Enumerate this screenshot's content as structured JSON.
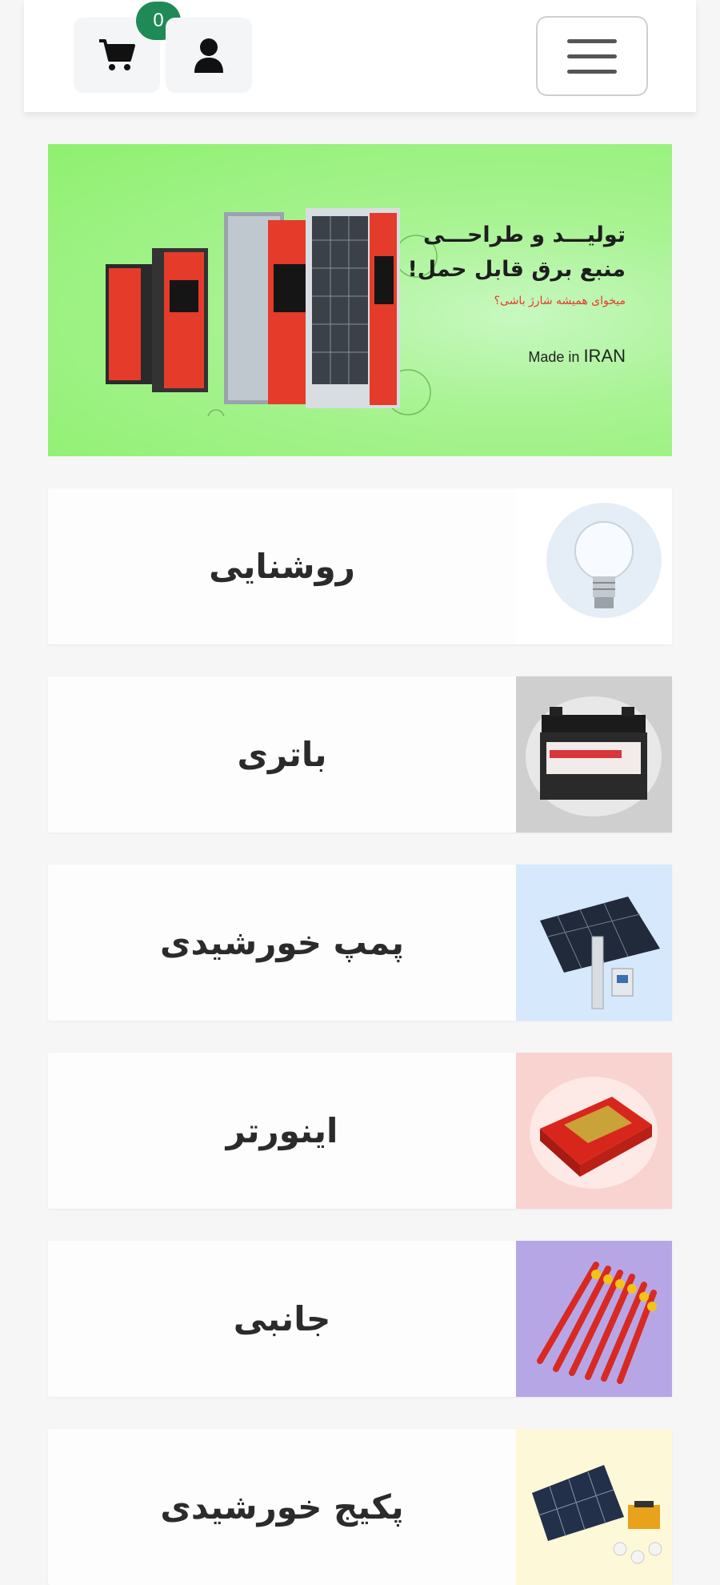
{
  "header": {
    "cart_count": "0",
    "cart_icon": "cart-icon",
    "user_icon": "user-icon",
    "menu_icon": "hamburger-icon"
  },
  "banner": {
    "title_line1": "تولیـــد و طراحـــی",
    "title_line2": "منبع برق قابل حمل!",
    "subtitle": "میخوای همیشه شارژ باشی؟",
    "made_in": "Made in",
    "made_country": "IRAN"
  },
  "categories": [
    {
      "label": "روشنایی",
      "icon": "light-bulb"
    },
    {
      "label": "باتری",
      "icon": "battery"
    },
    {
      "label": "پمپ خورشیدی",
      "icon": "solar-pump"
    },
    {
      "label": "اینورتر",
      "icon": "inverter"
    },
    {
      "label": "جانبی",
      "icon": "screwdrivers"
    },
    {
      "label": "پکیج خورشیدی",
      "icon": "solar-package"
    }
  ],
  "colors": {
    "badge": "#1f8a55",
    "banner_bg": "#8ff070",
    "accent_red": "#e53b2a"
  }
}
